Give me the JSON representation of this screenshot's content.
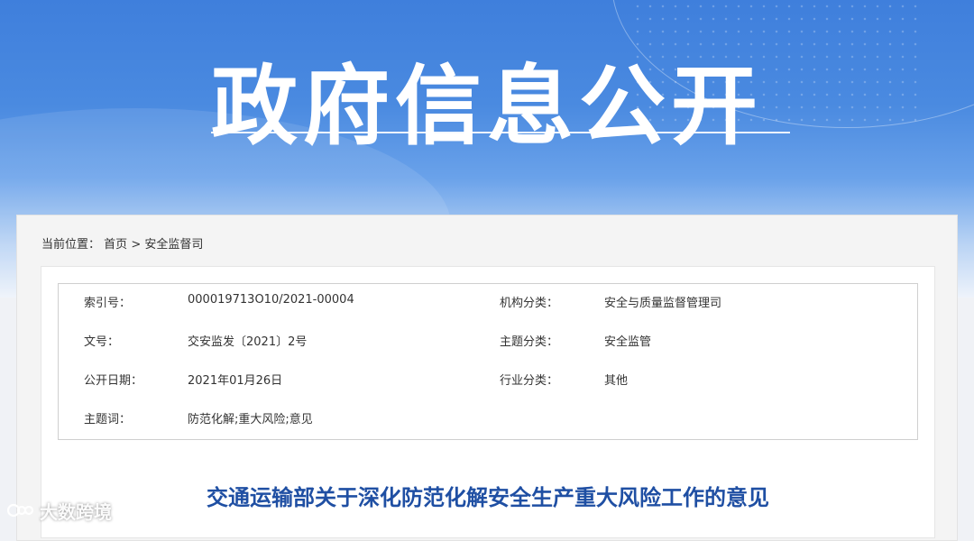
{
  "banner": {
    "title": "政府信息公开"
  },
  "breadcrumb": {
    "prefix": "当前位置：",
    "home": "首页",
    "separator": ">",
    "current": "安全监督司"
  },
  "meta": {
    "index_label": "索引号：",
    "index_value": "000019713O10/2021-00004",
    "org_label": "机构分类：",
    "org_value": "安全与质量监督管理司",
    "docno_label": "文号：",
    "docno_value": "交安监发〔2021〕2号",
    "topic_label": "主题分类：",
    "topic_value": "安全监管",
    "date_label": "公开日期：",
    "date_value": "2021年01月26日",
    "industry_label": "行业分类：",
    "industry_value": "其他",
    "keywords_label": "主题词：",
    "keywords_value": "防范化解;重大风险;意见"
  },
  "document": {
    "title": "交通运输部关于深化防范化解安全生产重大风险工作的意见"
  },
  "watermark": {
    "text": "大数跨境"
  }
}
